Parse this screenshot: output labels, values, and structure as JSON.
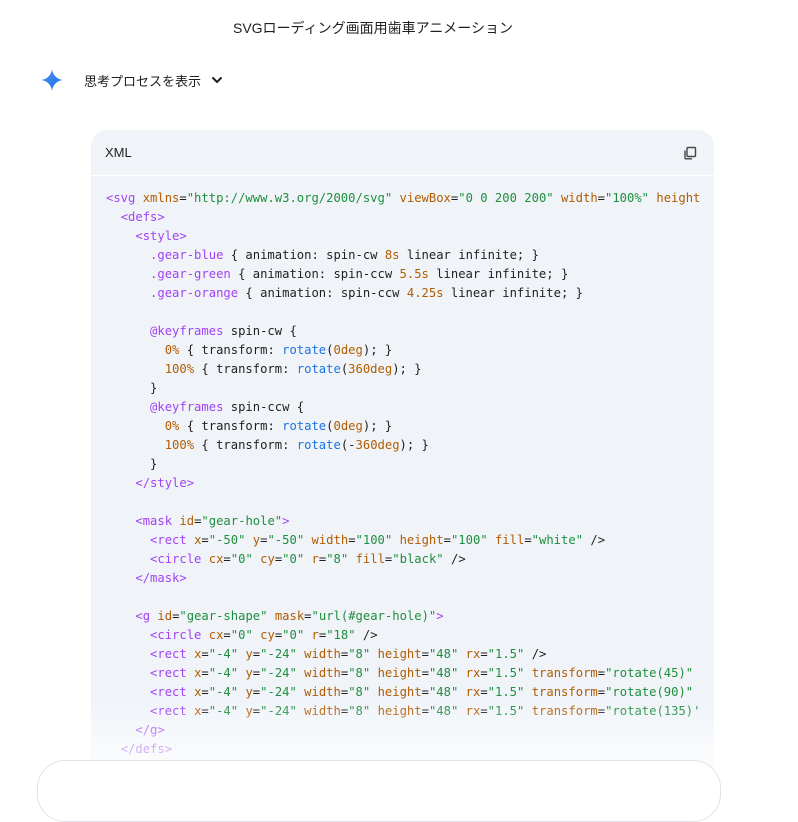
{
  "header": {
    "title": "SVGローディング画面用歯車アニメーション"
  },
  "thinking": {
    "label": "思考プロセスを表示",
    "icon": "gemini-spark-icon"
  },
  "code_block": {
    "language": "XML",
    "copy_icon": "copy-icon",
    "lines": [
      [
        [
          "t",
          "<svg "
        ],
        [
          "a",
          "xmlns"
        ],
        [
          "p",
          "="
        ],
        [
          "s",
          "\"http://www.w3.org/2000/svg\""
        ],
        [
          "p",
          " "
        ],
        [
          "a",
          "viewBox"
        ],
        [
          "p",
          "="
        ],
        [
          "s",
          "\"0 0 200 200\""
        ],
        [
          "p",
          " "
        ],
        [
          "a",
          "width"
        ],
        [
          "p",
          "="
        ],
        [
          "s",
          "\"100%\""
        ],
        [
          "p",
          " "
        ],
        [
          "a",
          "height"
        ]
      ],
      [
        [
          "p",
          "  "
        ],
        [
          "t",
          "<defs>"
        ]
      ],
      [
        [
          "p",
          "    "
        ],
        [
          "t",
          "<style>"
        ]
      ],
      [
        [
          "p",
          "      "
        ],
        [
          "k",
          ".gear-blue"
        ],
        [
          "p",
          " { animation: spin-cw "
        ],
        [
          "u",
          "8s"
        ],
        [
          "p",
          " linear infinite; }"
        ]
      ],
      [
        [
          "p",
          "      "
        ],
        [
          "k",
          ".gear-green"
        ],
        [
          "p",
          " { animation: spin-ccw "
        ],
        [
          "u",
          "5.5s"
        ],
        [
          "p",
          " linear infinite; }"
        ]
      ],
      [
        [
          "p",
          "      "
        ],
        [
          "k",
          ".gear-orange"
        ],
        [
          "p",
          " { animation: spin-ccw "
        ],
        [
          "u",
          "4.25s"
        ],
        [
          "p",
          " linear infinite; }"
        ]
      ],
      [
        [
          "p",
          ""
        ]
      ],
      [
        [
          "p",
          "      "
        ],
        [
          "k",
          "@keyframes"
        ],
        [
          "p",
          " spin-cw {"
        ]
      ],
      [
        [
          "p",
          "        "
        ],
        [
          "u",
          "0%"
        ],
        [
          "p",
          " { transform: "
        ],
        [
          "f",
          "rotate"
        ],
        [
          "p",
          "("
        ],
        [
          "u",
          "0deg"
        ],
        [
          "p",
          "); }"
        ]
      ],
      [
        [
          "p",
          "        "
        ],
        [
          "u",
          "100%"
        ],
        [
          "p",
          " { transform: "
        ],
        [
          "f",
          "rotate"
        ],
        [
          "p",
          "("
        ],
        [
          "u",
          "360deg"
        ],
        [
          "p",
          "); }"
        ]
      ],
      [
        [
          "p",
          "      }"
        ]
      ],
      [
        [
          "p",
          "      "
        ],
        [
          "k",
          "@keyframes"
        ],
        [
          "p",
          " spin-ccw {"
        ]
      ],
      [
        [
          "p",
          "        "
        ],
        [
          "u",
          "0%"
        ],
        [
          "p",
          " { transform: "
        ],
        [
          "f",
          "rotate"
        ],
        [
          "p",
          "("
        ],
        [
          "u",
          "0deg"
        ],
        [
          "p",
          "); }"
        ]
      ],
      [
        [
          "p",
          "        "
        ],
        [
          "u",
          "100%"
        ],
        [
          "p",
          " { transform: "
        ],
        [
          "f",
          "rotate"
        ],
        [
          "p",
          "(-"
        ],
        [
          "u",
          "360deg"
        ],
        [
          "p",
          "); }"
        ]
      ],
      [
        [
          "p",
          "      }"
        ]
      ],
      [
        [
          "p",
          "    "
        ],
        [
          "t",
          "</style>"
        ]
      ],
      [
        [
          "p",
          ""
        ]
      ],
      [
        [
          "p",
          "    "
        ],
        [
          "t",
          "<mask "
        ],
        [
          "a",
          "id"
        ],
        [
          "p",
          "="
        ],
        [
          "s",
          "\"gear-hole\""
        ],
        [
          "t",
          ">"
        ]
      ],
      [
        [
          "p",
          "      "
        ],
        [
          "t",
          "<rect "
        ],
        [
          "a",
          "x"
        ],
        [
          "p",
          "="
        ],
        [
          "s",
          "\"-50\""
        ],
        [
          "p",
          " "
        ],
        [
          "a",
          "y"
        ],
        [
          "p",
          "="
        ],
        [
          "s",
          "\"-50\""
        ],
        [
          "p",
          " "
        ],
        [
          "a",
          "width"
        ],
        [
          "p",
          "="
        ],
        [
          "s",
          "\"100\""
        ],
        [
          "p",
          " "
        ],
        [
          "a",
          "height"
        ],
        [
          "p",
          "="
        ],
        [
          "s",
          "\"100\""
        ],
        [
          "p",
          " "
        ],
        [
          "a",
          "fill"
        ],
        [
          "p",
          "="
        ],
        [
          "s",
          "\"white\""
        ],
        [
          "p",
          " />"
        ]
      ],
      [
        [
          "p",
          "      "
        ],
        [
          "t",
          "<circle "
        ],
        [
          "a",
          "cx"
        ],
        [
          "p",
          "="
        ],
        [
          "s",
          "\"0\""
        ],
        [
          "p",
          " "
        ],
        [
          "a",
          "cy"
        ],
        [
          "p",
          "="
        ],
        [
          "s",
          "\"0\""
        ],
        [
          "p",
          " "
        ],
        [
          "a",
          "r"
        ],
        [
          "p",
          "="
        ],
        [
          "s",
          "\"8\""
        ],
        [
          "p",
          " "
        ],
        [
          "a",
          "fill"
        ],
        [
          "p",
          "="
        ],
        [
          "s",
          "\"black\""
        ],
        [
          "p",
          " />"
        ]
      ],
      [
        [
          "p",
          "    "
        ],
        [
          "t",
          "</mask>"
        ]
      ],
      [
        [
          "p",
          ""
        ]
      ],
      [
        [
          "p",
          "    "
        ],
        [
          "t",
          "<g "
        ],
        [
          "a",
          "id"
        ],
        [
          "p",
          "="
        ],
        [
          "s",
          "\"gear-shape\""
        ],
        [
          "p",
          " "
        ],
        [
          "a",
          "mask"
        ],
        [
          "p",
          "="
        ],
        [
          "s",
          "\"url(#gear-hole)\""
        ],
        [
          "t",
          ">"
        ]
      ],
      [
        [
          "p",
          "      "
        ],
        [
          "t",
          "<circle "
        ],
        [
          "a",
          "cx"
        ],
        [
          "p",
          "="
        ],
        [
          "s",
          "\"0\""
        ],
        [
          "p",
          " "
        ],
        [
          "a",
          "cy"
        ],
        [
          "p",
          "="
        ],
        [
          "s",
          "\"0\""
        ],
        [
          "p",
          " "
        ],
        [
          "a",
          "r"
        ],
        [
          "p",
          "="
        ],
        [
          "s",
          "\"18\""
        ],
        [
          "p",
          " />"
        ]
      ],
      [
        [
          "p",
          "      "
        ],
        [
          "t",
          "<rect "
        ],
        [
          "a",
          "x"
        ],
        [
          "p",
          "="
        ],
        [
          "s",
          "\"-4\""
        ],
        [
          "p",
          " "
        ],
        [
          "a",
          "y"
        ],
        [
          "p",
          "="
        ],
        [
          "s",
          "\"-24\""
        ],
        [
          "p",
          " "
        ],
        [
          "a",
          "width"
        ],
        [
          "p",
          "="
        ],
        [
          "s",
          "\"8\""
        ],
        [
          "p",
          " "
        ],
        [
          "a",
          "height"
        ],
        [
          "p",
          "="
        ],
        [
          "s",
          "\"48\""
        ],
        [
          "p",
          " "
        ],
        [
          "a",
          "rx"
        ],
        [
          "p",
          "="
        ],
        [
          "s",
          "\"1.5\""
        ],
        [
          "p",
          " />"
        ]
      ],
      [
        [
          "p",
          "      "
        ],
        [
          "t",
          "<rect "
        ],
        [
          "a",
          "x"
        ],
        [
          "p",
          "="
        ],
        [
          "s",
          "\"-4\""
        ],
        [
          "p",
          " "
        ],
        [
          "a",
          "y"
        ],
        [
          "p",
          "="
        ],
        [
          "s",
          "\"-24\""
        ],
        [
          "p",
          " "
        ],
        [
          "a",
          "width"
        ],
        [
          "p",
          "="
        ],
        [
          "s",
          "\"8\""
        ],
        [
          "p",
          " "
        ],
        [
          "a",
          "height"
        ],
        [
          "p",
          "="
        ],
        [
          "s",
          "\"48\""
        ],
        [
          "p",
          " "
        ],
        [
          "a",
          "rx"
        ],
        [
          "p",
          "="
        ],
        [
          "s",
          "\"1.5\""
        ],
        [
          "p",
          " "
        ],
        [
          "a",
          "transform"
        ],
        [
          "p",
          "="
        ],
        [
          "s",
          "\"rotate(45)\""
        ]
      ],
      [
        [
          "p",
          "      "
        ],
        [
          "t",
          "<rect "
        ],
        [
          "a",
          "x"
        ],
        [
          "p",
          "="
        ],
        [
          "s",
          "\"-4\""
        ],
        [
          "p",
          " "
        ],
        [
          "a",
          "y"
        ],
        [
          "p",
          "="
        ],
        [
          "s",
          "\"-24\""
        ],
        [
          "p",
          " "
        ],
        [
          "a",
          "width"
        ],
        [
          "p",
          "="
        ],
        [
          "s",
          "\"8\""
        ],
        [
          "p",
          " "
        ],
        [
          "a",
          "height"
        ],
        [
          "p",
          "="
        ],
        [
          "s",
          "\"48\""
        ],
        [
          "p",
          " "
        ],
        [
          "a",
          "rx"
        ],
        [
          "p",
          "="
        ],
        [
          "s",
          "\"1.5\""
        ],
        [
          "p",
          " "
        ],
        [
          "a",
          "transform"
        ],
        [
          "p",
          "="
        ],
        [
          "s",
          "\"rotate(90)\""
        ]
      ],
      [
        [
          "p",
          "      "
        ],
        [
          "t",
          "<rect "
        ],
        [
          "a",
          "x"
        ],
        [
          "p",
          "="
        ],
        [
          "s",
          "\"-4\""
        ],
        [
          "p",
          " "
        ],
        [
          "a",
          "y"
        ],
        [
          "p",
          "="
        ],
        [
          "s",
          "\"-24\""
        ],
        [
          "p",
          " "
        ],
        [
          "a",
          "width"
        ],
        [
          "p",
          "="
        ],
        [
          "s",
          "\"8\""
        ],
        [
          "p",
          " "
        ],
        [
          "a",
          "height"
        ],
        [
          "p",
          "="
        ],
        [
          "s",
          "\"48\""
        ],
        [
          "p",
          " "
        ],
        [
          "a",
          "rx"
        ],
        [
          "p",
          "="
        ],
        [
          "s",
          "\"1.5\""
        ],
        [
          "p",
          " "
        ],
        [
          "a",
          "transform"
        ],
        [
          "p",
          "="
        ],
        [
          "s",
          "\"rotate(135)'"
        ]
      ],
      [
        [
          "p",
          "    "
        ],
        [
          "t",
          "</g>"
        ]
      ],
      [
        [
          "p",
          "  "
        ],
        [
          "t",
          "</defs>"
        ]
      ]
    ]
  }
}
